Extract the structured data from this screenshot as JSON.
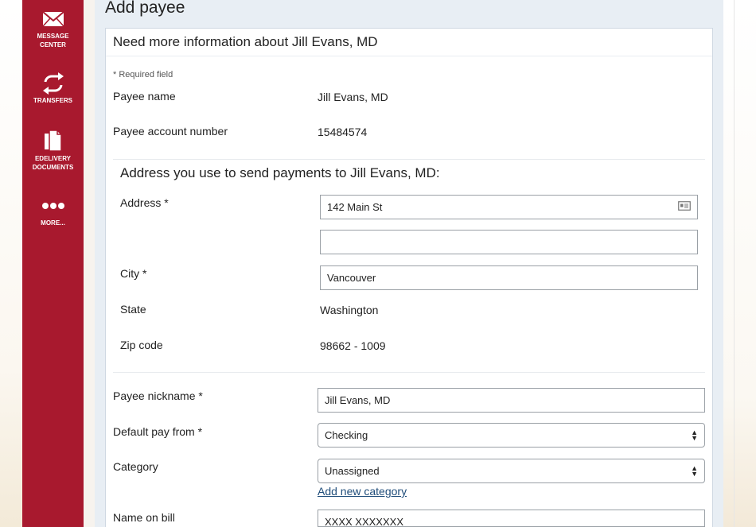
{
  "sidebar": {
    "items": [
      {
        "label_line1": "MESSAGE",
        "label_line2": "CENTER",
        "icon": "envelope-icon"
      },
      {
        "label_line1": "TRANSFERS",
        "label_line2": "",
        "icon": "transfer-arrows-icon"
      },
      {
        "label_line1": "EDELIVERY",
        "label_line2": "DOCUMENTS",
        "icon": "documents-icon"
      },
      {
        "label_line1": "MORE...",
        "label_line2": "",
        "icon": "more-dots-icon"
      }
    ]
  },
  "page": {
    "title": "Add payee"
  },
  "card": {
    "header": "Need more information about Jill Evans, MD",
    "required_note": "* Required field",
    "payee_name_label": "Payee name",
    "payee_name_value": "Jill Evans, MD",
    "account_label": "Payee account number",
    "account_value": "15484574"
  },
  "address": {
    "title": "Address you use to send payments to Jill Evans, MD:",
    "address_label": "Address *",
    "address_line1": "142 Main St",
    "address_line2": "",
    "city_label": "City *",
    "city_value": "Vancouver",
    "state_label": "State",
    "state_value": "Washington",
    "zip_label": "Zip code",
    "zip_value": "98662 - 1009"
  },
  "details": {
    "nickname_label": "Payee nickname *",
    "nickname_value": "Jill Evans, MD",
    "pay_from_label": "Default pay from *",
    "pay_from_value": "Checking",
    "category_label": "Category",
    "category_value": "Unassigned",
    "add_category_link": "Add new category",
    "name_on_bill_label": "Name on bill",
    "name_on_bill_value": "XXXX XXXXXXX"
  },
  "colors": {
    "sidebar": "#a8192e",
    "panel": "#e8eef4",
    "link": "#1f4d7a"
  }
}
